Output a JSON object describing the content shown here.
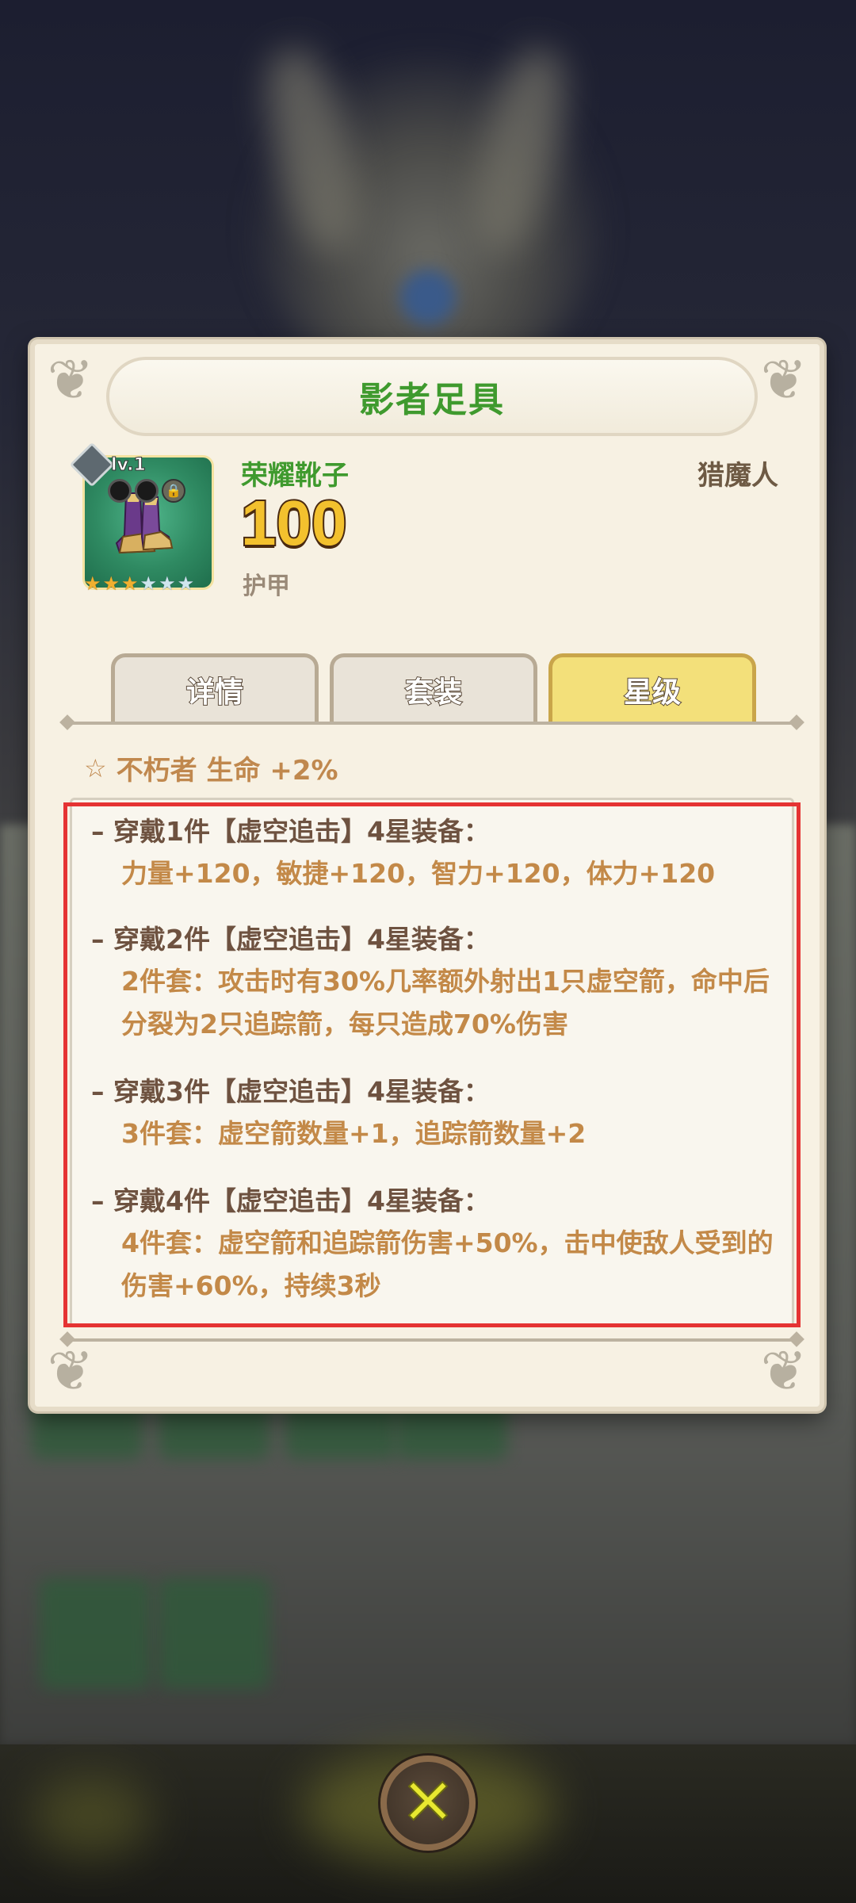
{
  "dialog": {
    "title": "影者足具"
  },
  "item": {
    "level": "lv.1",
    "name": "荣耀靴子",
    "class": "猎魔人",
    "value": "100",
    "stat_label": "护甲",
    "stars_filled": 3,
    "stars_total": 6
  },
  "tabs": [
    {
      "label": "详情",
      "active": false
    },
    {
      "label": "套装",
      "active": false
    },
    {
      "label": "星级",
      "active": true
    }
  ],
  "passive": {
    "text": "不朽者 生命 +2%"
  },
  "set_bonuses": [
    {
      "head": "– 穿戴1件【虚空追击】4星装备：",
      "body": "力量+120，敏捷+120，智力+120，体力+120"
    },
    {
      "head": "– 穿戴2件【虚空追击】4星装备：",
      "body": "2件套：攻击时有30%几率额外射出1只虚空箭，命中后分裂为2只追踪箭，每只造成70%伤害"
    },
    {
      "head": "– 穿戴3件【虚空追击】4星装备：",
      "body": "3件套：虚空箭数量+1，追踪箭数量+2"
    },
    {
      "head": "– 穿戴4件【虚空追击】4星装备：",
      "body": "4件套：虚空箭和追踪箭伤害+50%，击中使敌人受到的伤害+60%，持续3秒"
    }
  ],
  "close_icon": "close-x-icon",
  "colors": {
    "title_green": "#3f9a2e",
    "value_gold": "#f3c12e",
    "set_text_orange": "#c38948",
    "highlight_red": "#e53333",
    "tab_active": "#f3e07a"
  }
}
